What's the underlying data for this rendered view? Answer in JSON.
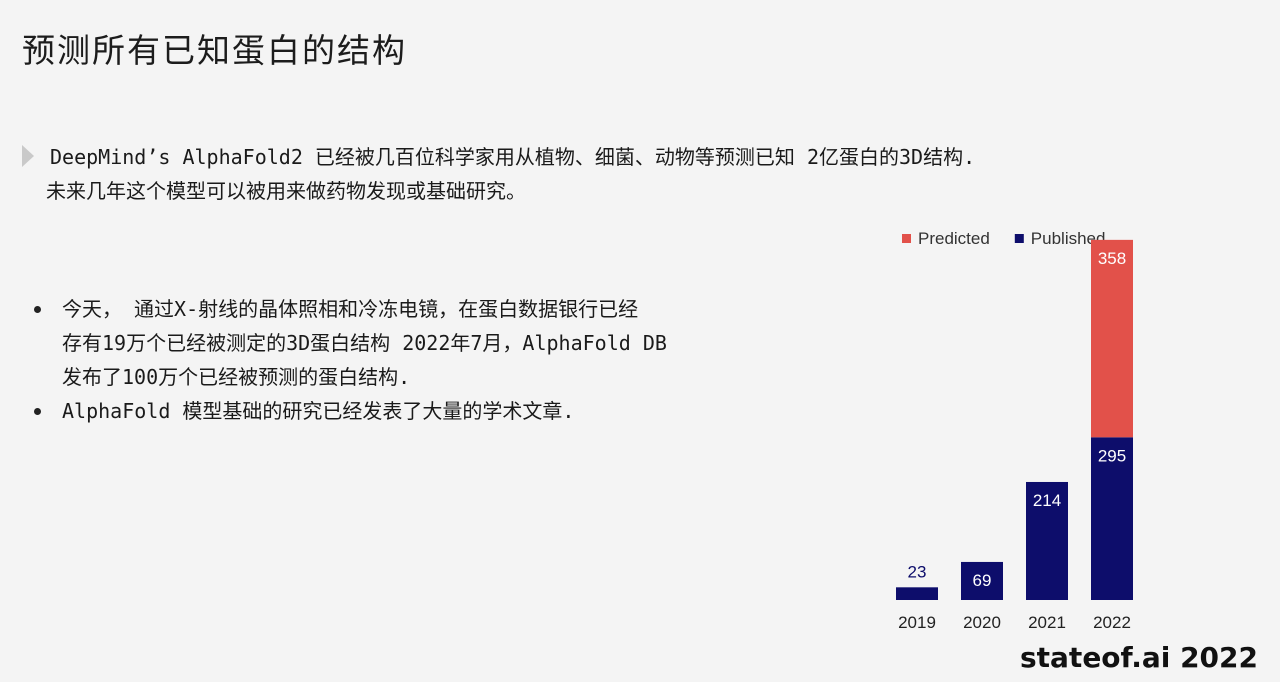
{
  "title": "预测所有已知蛋白的结构",
  "intro": {
    "line1": "DeepMind’s AlphaFold2 已经被几百位科学家用从植物、细菌、动物等预测已知 2亿蛋白的3D结构.",
    "line2": "未来几年这个模型可以被用来做药物发现或基础研究。"
  },
  "bullets": [
    {
      "lines": [
        " 今天， 通过X-射线的晶体照相和冷冻电镜，在蛋白数据银行已经",
        "存有19万个已经被测定的3D蛋白结构  2022年7月，AlphaFold DB",
        "发布了100万个已经被预测的蛋白结构."
      ]
    },
    {
      "lines": [
        "AlphaFold 模型基础的研究已经发表了大量的学术文章."
      ]
    }
  ],
  "footer": "stateof.ai 2022",
  "chart_data": {
    "type": "bar",
    "stacked": true,
    "categories": [
      "2019",
      "2020",
      "2021",
      "2022"
    ],
    "series": [
      {
        "name": "Published",
        "color": "#0d0d6b",
        "values": [
          23,
          69,
          214,
          295
        ]
      },
      {
        "name": "Predicted",
        "color": "#e2514a",
        "values": [
          0,
          0,
          0,
          358
        ]
      }
    ],
    "legend": "top",
    "ylim": [
      0,
      660
    ],
    "grid": false
  }
}
